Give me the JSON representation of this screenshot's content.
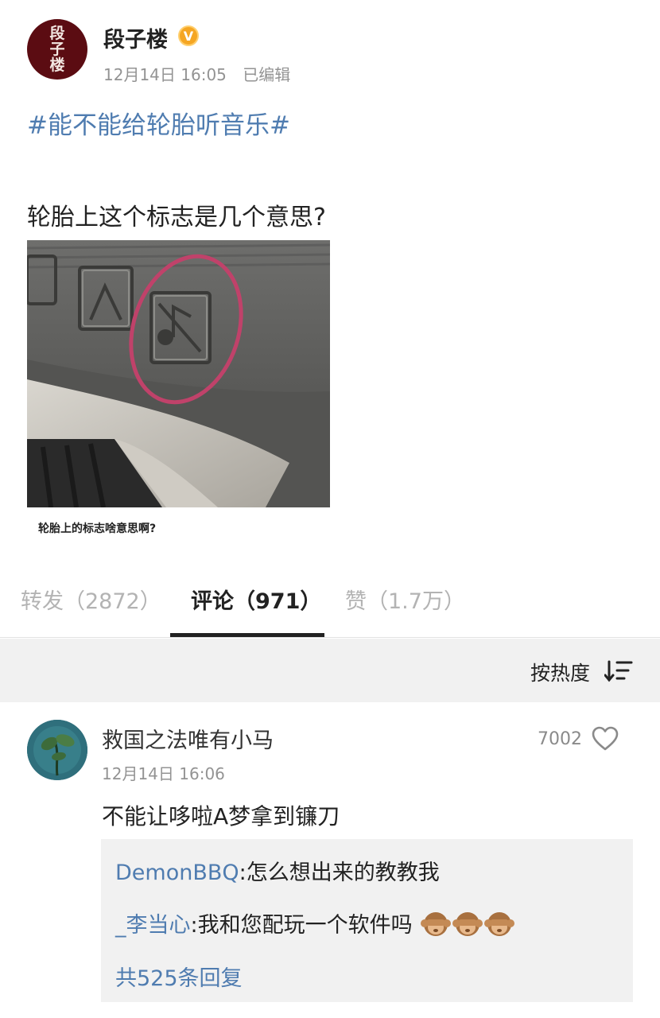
{
  "post": {
    "author": "段子楼",
    "avatar_text": [
      "段",
      "子",
      "楼"
    ],
    "verified_icon": "verified-v-icon",
    "date": "12月14日 16:05",
    "edited": "已编辑",
    "hashtag": "#能不能给轮胎听音乐#",
    "text": "轮胎上这个标志是几个意思?",
    "image_caption": "轮胎上的标志啥意思啊?"
  },
  "tabs": [
    {
      "label": "转发（2872）",
      "active": false
    },
    {
      "label": "评论（971）",
      "active": true
    },
    {
      "label": "赞（1.7万）",
      "active": false
    }
  ],
  "sort": {
    "label": "按热度",
    "icon": "sort-icon"
  },
  "comment": {
    "author": "救国之法唯有小马",
    "time": "12月14日 16:06",
    "likes": "7002",
    "text": "不能让哆啦A梦拿到镰刀",
    "replies": [
      {
        "user": "DemonBBQ",
        "text": ":怎么想出来的教教我"
      },
      {
        "user": "_李当心",
        "text": ":我和您配玩一个软件吗"
      }
    ],
    "more_replies": "共525条回复"
  },
  "colors": {
    "link_blue": "#4f7cb0",
    "meta_gray": "#939393",
    "avatar_red": "#5b0c12",
    "verified_orange": "#f5a623",
    "panel_gray": "#f1f1f1"
  }
}
